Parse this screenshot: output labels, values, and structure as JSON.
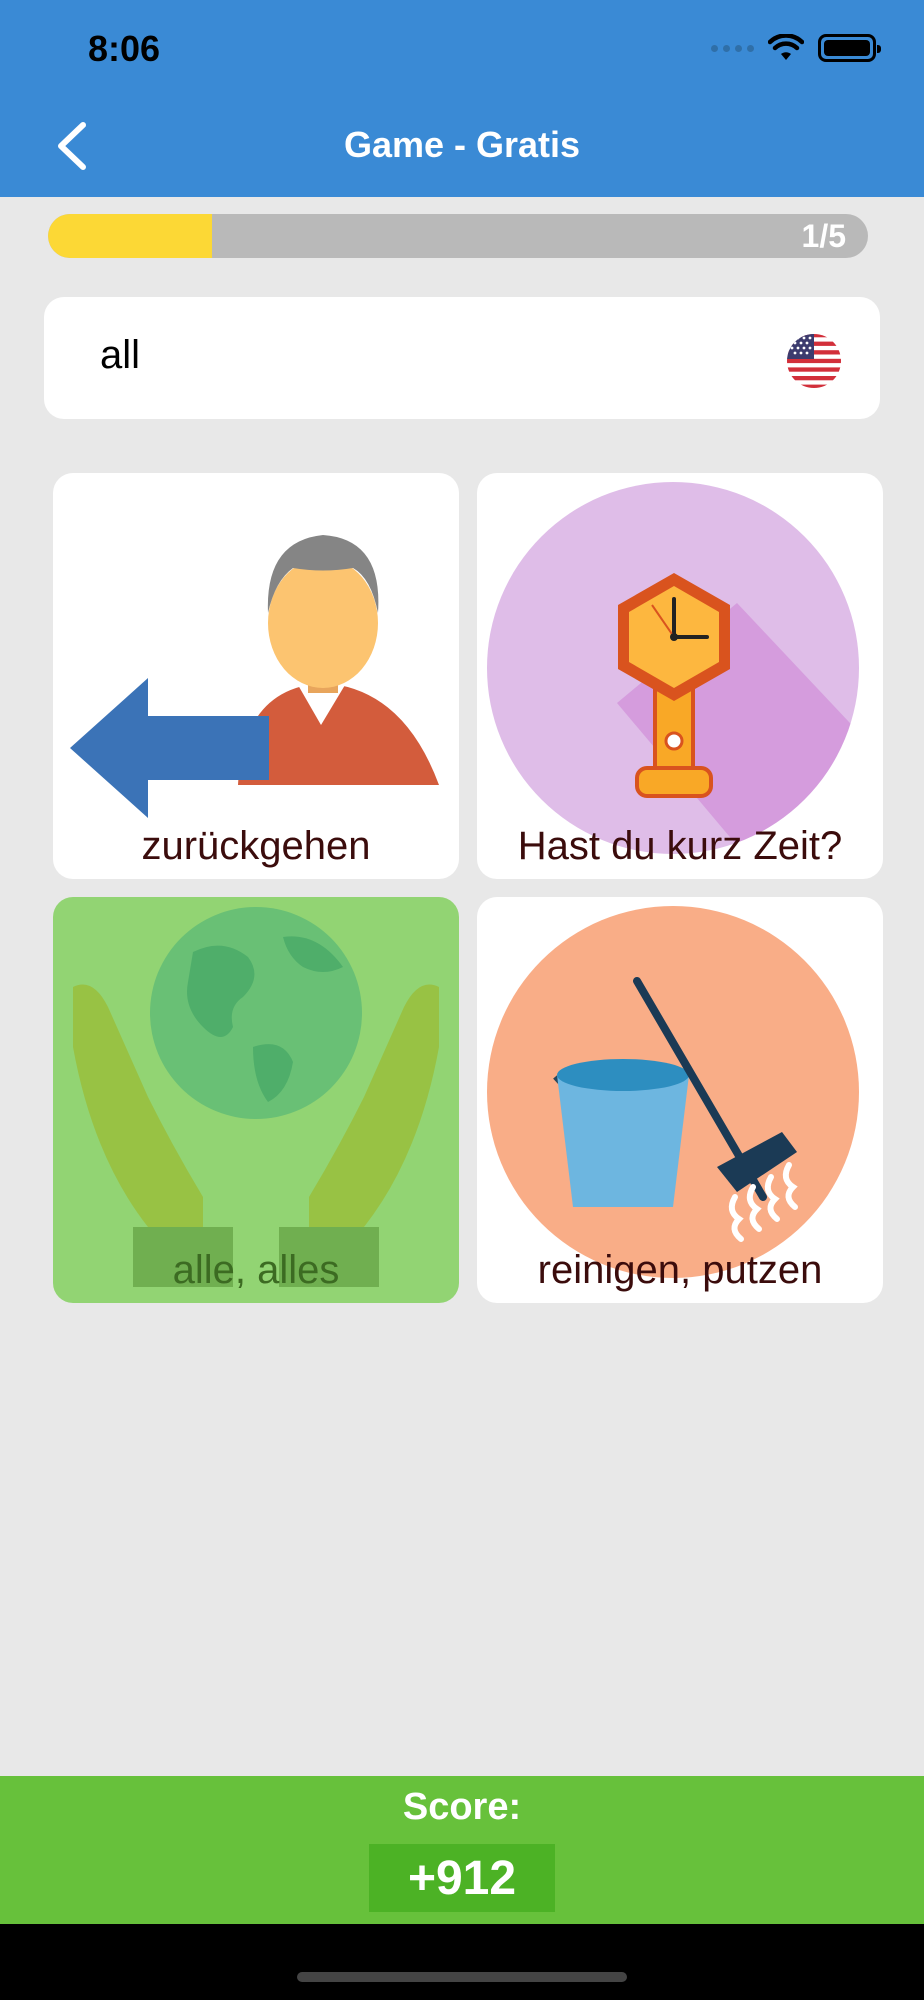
{
  "status_bar": {
    "time": "8:06"
  },
  "nav": {
    "title": "Game - Gratis",
    "back_icon": "chevron-left-icon"
  },
  "progress": {
    "label": "1/5",
    "fraction": 0.2,
    "color": "#fcd835"
  },
  "question": {
    "word": "all",
    "language_flag": "us-flag-icon"
  },
  "choices": [
    {
      "label": "zurückgehen",
      "icon": "person-arrow-back-icon"
    },
    {
      "label": "Hast du kurz Zeit?",
      "icon": "pendulum-clock-icon"
    },
    {
      "label": "alle, alles",
      "icon": "globe-in-hands-icon",
      "selected_correct": true
    },
    {
      "label": "reinigen, putzen",
      "icon": "bucket-rake-icon"
    }
  ],
  "score": {
    "label": "Score:",
    "value": "+912"
  },
  "colors": {
    "header": "#3a8ad5",
    "score_bar": "#67c13b",
    "correct_tile": "#92d473"
  }
}
